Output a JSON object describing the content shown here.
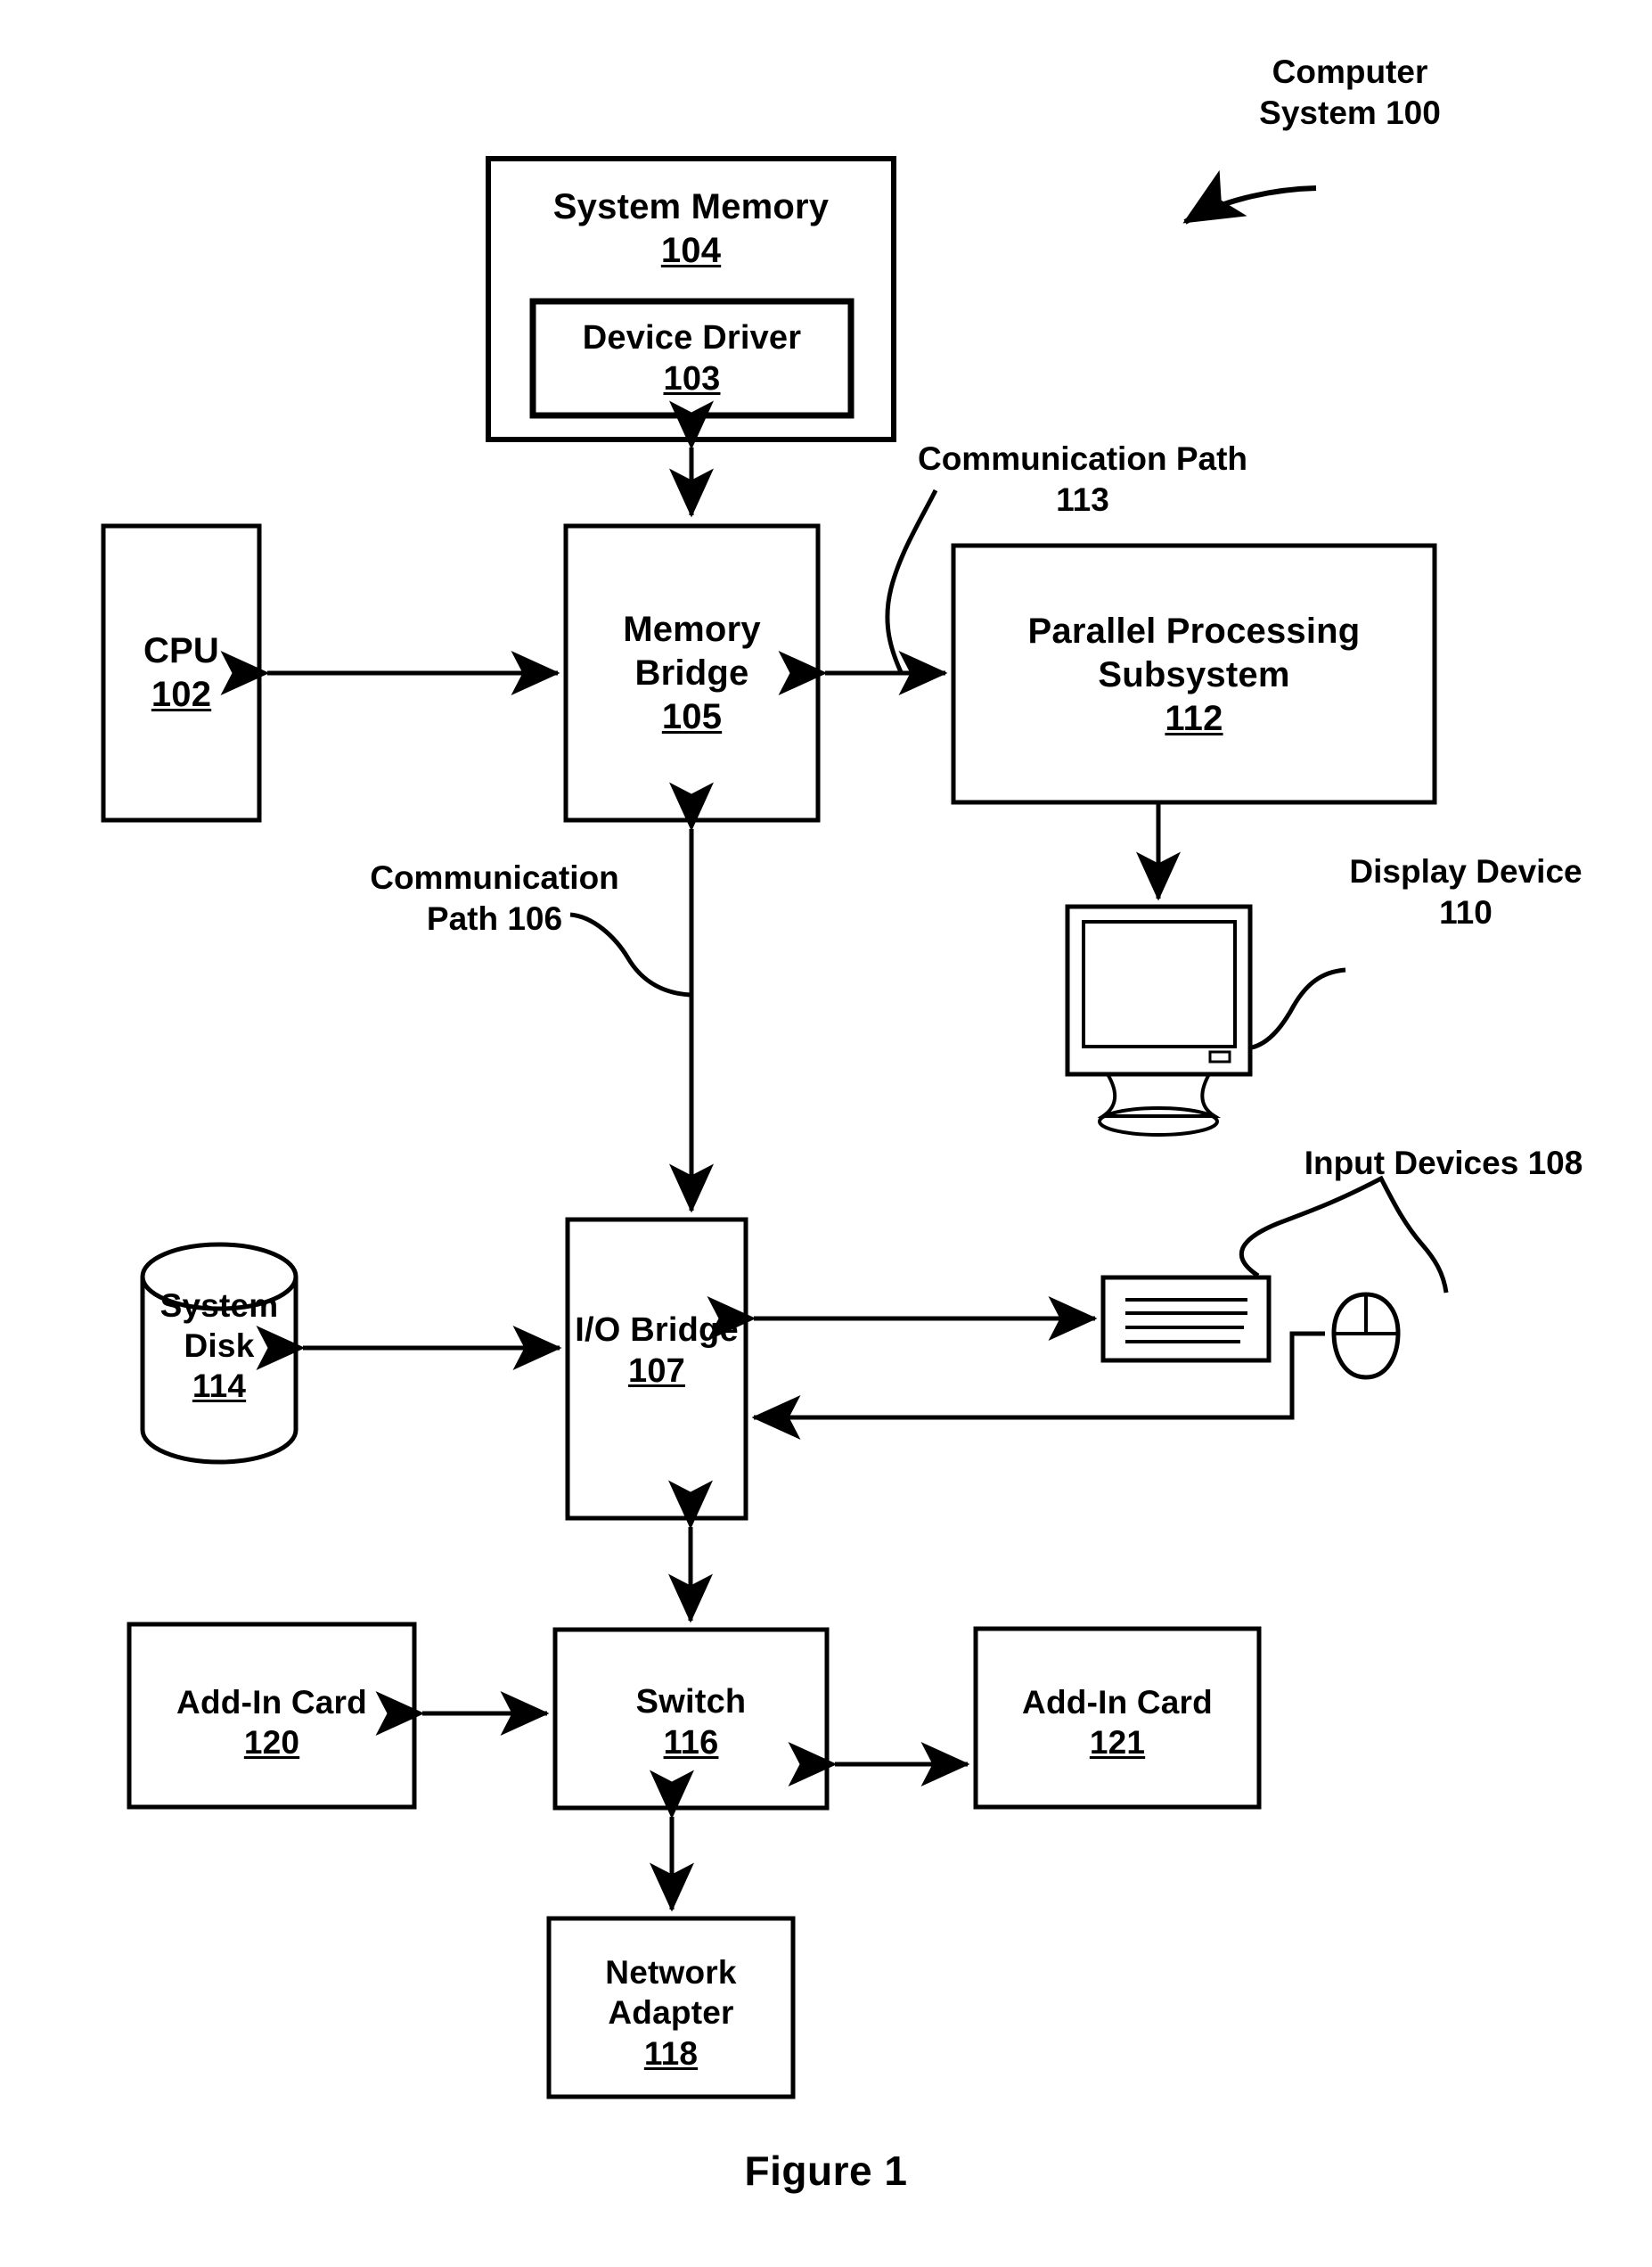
{
  "figure": {
    "caption": "Figure 1"
  },
  "annotations": {
    "computer_system": {
      "line1": "Computer",
      "line2": "System",
      "number": "100"
    },
    "comm_path_113": {
      "line1": "Communication Path",
      "number": "113"
    },
    "comm_path_106": {
      "line1": "Communication",
      "line2": "Path",
      "number": "106"
    },
    "display_device": {
      "line1": "Display",
      "line2": "Device",
      "number": "110"
    },
    "input_devices": {
      "line1": "Input Devices",
      "number": "108"
    }
  },
  "blocks": {
    "system_memory": {
      "title": "System Memory",
      "number": "104"
    },
    "device_driver": {
      "title": "Device Driver",
      "number": "103"
    },
    "cpu": {
      "title": "CPU",
      "number": "102"
    },
    "memory_bridge": {
      "line1": "Memory",
      "line2": "Bridge",
      "number": "105"
    },
    "parallel_processing_subsystem": {
      "line1": "Parallel Processing",
      "line2": "Subsystem",
      "number": "112"
    },
    "system_disk": {
      "line1": "System",
      "line2": "Disk",
      "number": "114"
    },
    "io_bridge": {
      "title": "I/O Bridge",
      "number": "107"
    },
    "switch": {
      "title": "Switch",
      "number": "116"
    },
    "add_in_card_120": {
      "title": "Add-In Card",
      "number": "120"
    },
    "add_in_card_121": {
      "title": "Add-In Card",
      "number": "121"
    },
    "network_adapter": {
      "line1": "Network",
      "line2": "Adapter",
      "number": "118"
    }
  },
  "icons": {
    "display_monitor": "monitor-icon",
    "keyboard": "keyboard-icon",
    "mouse": "mouse-icon",
    "disk_cylinder": "cylinder-icon"
  },
  "colors": {
    "stroke": "#000000",
    "background": "#ffffff"
  }
}
